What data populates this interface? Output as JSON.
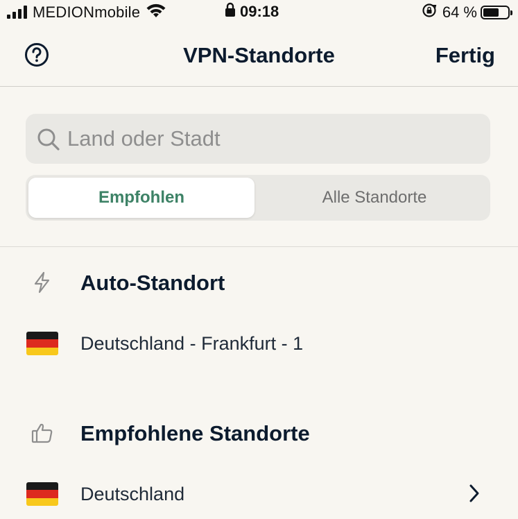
{
  "status_bar": {
    "carrier": "MEDIONmobile",
    "time": "09:18",
    "battery_percent": "64 %",
    "battery_level": 0.64,
    "icons": [
      "signal-icon",
      "wifi-icon",
      "lock-icon",
      "orientation-lock-icon",
      "battery-icon"
    ]
  },
  "nav": {
    "title": "VPN-Standorte",
    "done_label": "Fertig",
    "help_icon": "question-circle-icon"
  },
  "search": {
    "placeholder": "Land oder Stadt",
    "value": ""
  },
  "segments": [
    {
      "label": "Empfohlen",
      "selected": true
    },
    {
      "label": "Alle Standorte",
      "selected": false
    }
  ],
  "sections": {
    "auto": {
      "icon": "lightning-icon",
      "title": "Auto-Standort",
      "rows": [
        {
          "flag": "germany-flag-icon",
          "label": "Deutschland - Frankfurt - 1"
        }
      ]
    },
    "recommended": {
      "icon": "thumbs-up-icon",
      "title": "Empfohlene Standorte",
      "rows": [
        {
          "flag": "germany-flag-icon",
          "label": "Deutschland",
          "chevron": "chevron-right-icon"
        }
      ]
    }
  },
  "colors": {
    "background": "#f8f6f1",
    "accent_green": "#3d8266",
    "text_dark": "#0c1b2e",
    "field_bg": "#e9e8e4"
  }
}
